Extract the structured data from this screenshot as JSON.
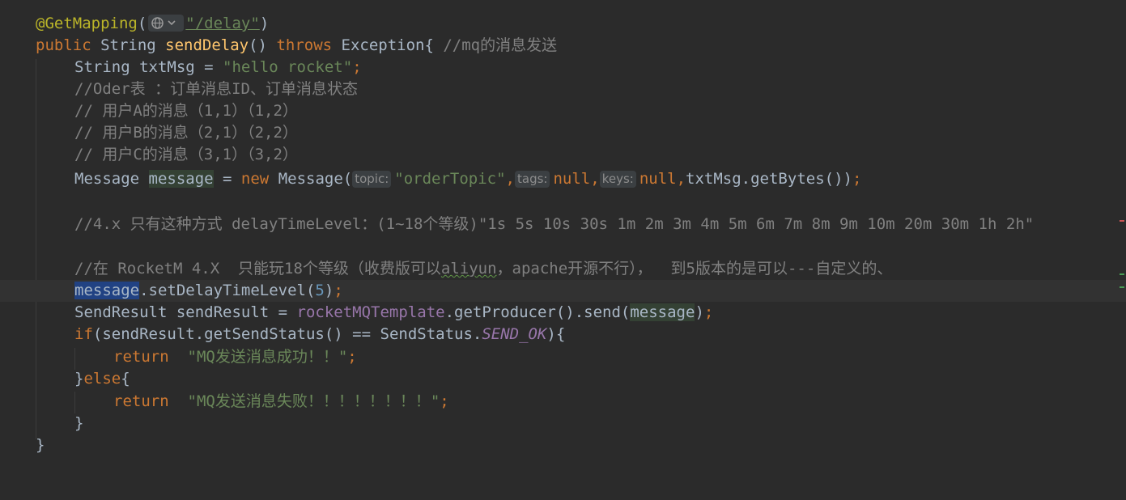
{
  "editor": {
    "annotation": "@GetMapping",
    "mapping_path": "\"/delay\"",
    "globe_icon": "globe-icon",
    "lines": {
      "l2_kw_public": "public",
      "l2_type": " String ",
      "l2_fn": "sendDelay",
      "l2_parens": "() ",
      "l2_kw_throws": "throws",
      "l2_exc": " Exception{ ",
      "l2_cmt": "//mq的消息发送",
      "l3_pre": "String txtMsg = ",
      "l3_str": "\"hello rocket\"",
      "l3_semi": ";",
      "l4_cmt": "//Oder表 ：订单消息ID、订单消息状态",
      "l5_cmt": "// 用户A的消息（1,1）（1,2）",
      "l6_cmt": "// 用户B的消息（2,1）（2,2）",
      "l7_cmt": "// 用户C的消息（3,1）（3,2）",
      "l8_type": "Message ",
      "l8_var": "message",
      "l8_eq": " = ",
      "l8_new": "new",
      "l8_ctor": " Message(",
      "l8_hint_topic": "topic:",
      "l8_topic": "\"orderTopic\"",
      "l8_comma1": ",",
      "l8_hint_tags": "tags:",
      "l8_null1": "null",
      "l8_comma2": ",",
      "l8_hint_keys": "keys:",
      "l8_null2": "null",
      "l8_comma3": ",",
      "l8_rest": "txtMsg.getBytes())",
      "l8_semi": ";",
      "l10_cmt": "//4.x 只有这种方式 delayTimeLevel：(1~18个等级)\"1s 5s 10s 30s 1m 2m 3m 4m 5m 6m 7m 8m 9m 10m 20m 30m 1h 2h\"",
      "l12_cmt_a": "//在 RocketM 4.X  只能玩18个等级（收费版可以",
      "l12_cmt_warn": "aliyun",
      "l12_cmt_b": "，apache开源不行），  到5版本的是可以---自定义的、",
      "l13_sel": "message",
      "l13_call": ".setDelayTimeLevel(",
      "l13_num": "5",
      "l13_close": ")",
      "l13_semi": ";",
      "l14_pre": "SendResult sendResult = ",
      "l14_bean": "rocketMQTemplate",
      "l14_call": ".getProducer().send(",
      "l14_arg": "message",
      "l14_close": ")",
      "l14_semi": ";",
      "l15_if": "if",
      "l15_mid": "(sendResult.getSendStatus() == SendStatus.",
      "l15_field": "SEND_OK",
      "l15_end": "){",
      "l16_ret": "return",
      "l16_str": "\"MQ发送消息成功！！\"",
      "l16_semi": ";",
      "l17_brace": "}",
      "l17_else": "else",
      "l17_open": "{",
      "l18_ret": "return",
      "l18_str": "\"MQ发送消息失败！！！！！！！！\"",
      "l18_semi": ";",
      "l19_brace": "}",
      "l20_brace": "}"
    }
  }
}
